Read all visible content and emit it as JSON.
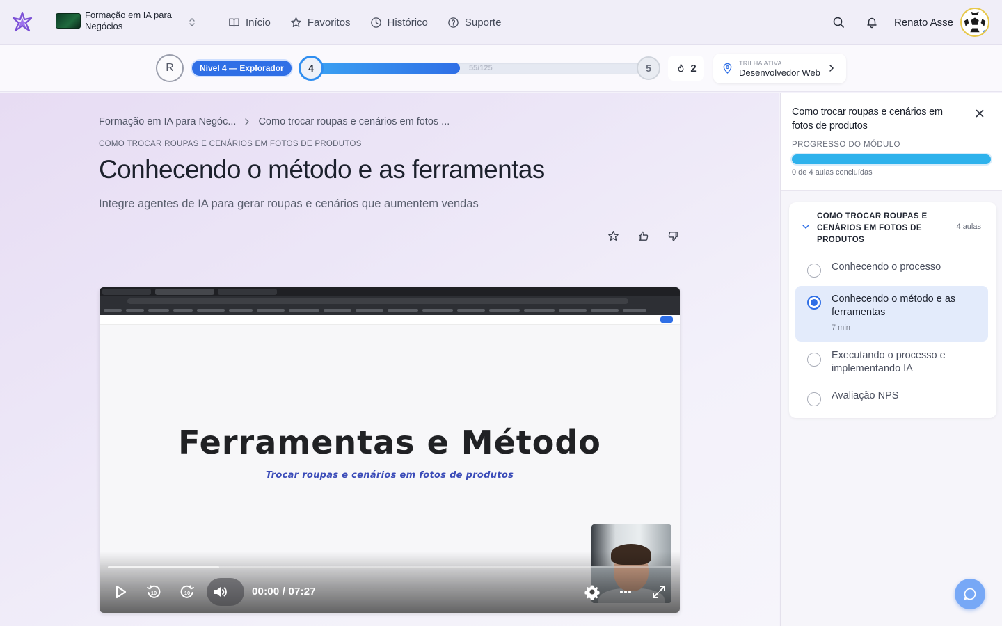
{
  "topbar": {
    "logo_icon": "sparkle-star-logo",
    "org_name": "Formação em IA para Negócios",
    "nav": [
      {
        "label": "Início",
        "icon": "book-open-icon"
      },
      {
        "label": "Favoritos",
        "icon": "star-icon"
      },
      {
        "label": "Histórico",
        "icon": "clock-icon"
      },
      {
        "label": "Suporte",
        "icon": "help-circle-icon"
      }
    ],
    "user_name": "Renato Asse"
  },
  "progress": {
    "avatar_initial": "R",
    "level_badge": "Nível 4 — Explorador",
    "current_level": "4",
    "xp_text": "55/125",
    "xp_fraction": 0.44,
    "next_level": "5",
    "streak": "2",
    "track_label": "TRILHA ATIVA",
    "track_name": "Desenvolvedor Web"
  },
  "main": {
    "breadcrumbs": [
      "Formação em IA para Negóc...",
      "Como trocar roupas e cenários em fotos ..."
    ],
    "eyebrow": "COMO TROCAR ROUPAS E CENÁRIOS EM FOTOS DE PRODUTOS",
    "title": "Conhecendo o método e as ferramentas",
    "subtitle": "Integre agentes de IA para gerar roupas e cenários que aumentem vendas"
  },
  "video": {
    "slide_title": "Ferramentas e Método",
    "slide_subtitle": "Trocar roupas e cenários em fotos de produtos",
    "time_current": "00:00",
    "time_total": "/ 07:27",
    "progress_fraction": 0.0
  },
  "panel": {
    "title": "Como trocar roupas e cenários em fotos de produtos",
    "progress_label": "PROGRESSO DO MÓDULO",
    "progress_count": "0 de 4 aulas concluídas",
    "module_title": "COMO TROCAR ROUPAS E CENÁRIOS EM FOTOS DE PRODUTOS",
    "module_count": "4 aulas",
    "lessons": [
      {
        "title": "Conhecendo o processo",
        "duration": ""
      },
      {
        "title": "Conhecendo o método e as ferramentas",
        "duration": "7 min"
      },
      {
        "title": "Executando o processo e implementando IA",
        "duration": ""
      },
      {
        "title": "Avaliação NPS",
        "duration": ""
      }
    ]
  },
  "colors": {
    "accent": "#2f6fe6",
    "progress_cyan": "#2eb2ec"
  }
}
